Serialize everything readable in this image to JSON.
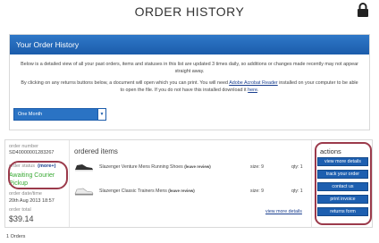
{
  "page": {
    "title": "ORDER HISTORY"
  },
  "icons": {
    "lock": "padlock-icon"
  },
  "panel": {
    "header": "Your Order History",
    "para1": "Below is a detailed view of all your past orders, items and statuses in this list are updated 3 times daily, so additions or changes made recently may not appear straight away.",
    "para2_a": "By clicking on any returns buttons below, a document will open which you can print. You will need ",
    "para2_link": "Adobe Acrobat Reader",
    "para2_b": " installed on your computer to be able to open the file. If you do not have this installed download it ",
    "para2_here": "here",
    "para2_end": ".",
    "select_value": "One Month"
  },
  "order": {
    "number_label": "order number",
    "number": "SD40000001283267",
    "status_label": "order status",
    "status_more": "(more+)",
    "status_line1": "Awaiting Courier",
    "status_line2": "Pickup",
    "date_label": "order date/time",
    "date": "20th Aug 2013 18:57",
    "total_label": "order total",
    "total": "$39.14"
  },
  "items": {
    "title": "ordered items",
    "rows": [
      {
        "name": "Slazenger Venture Mens Running Shoes",
        "review": "(leave review)",
        "size": "size: 9",
        "qty": "qty: 1"
      },
      {
        "name": "Slazenger Classic Trainers Mens",
        "review": "(leave review)",
        "size": "size: 9",
        "qty": "qty: 1"
      }
    ],
    "view_more": "view more details"
  },
  "actions": {
    "title": "actions",
    "buttons": [
      "view more details",
      "track your order",
      "contact us",
      "print invoice",
      "returns form"
    ]
  },
  "footer": {
    "orders_count": "1 Orders"
  },
  "colors": {
    "accent": "#1d5fb0",
    "status": "#3aaa35",
    "highlight": "#9b3a4b"
  }
}
